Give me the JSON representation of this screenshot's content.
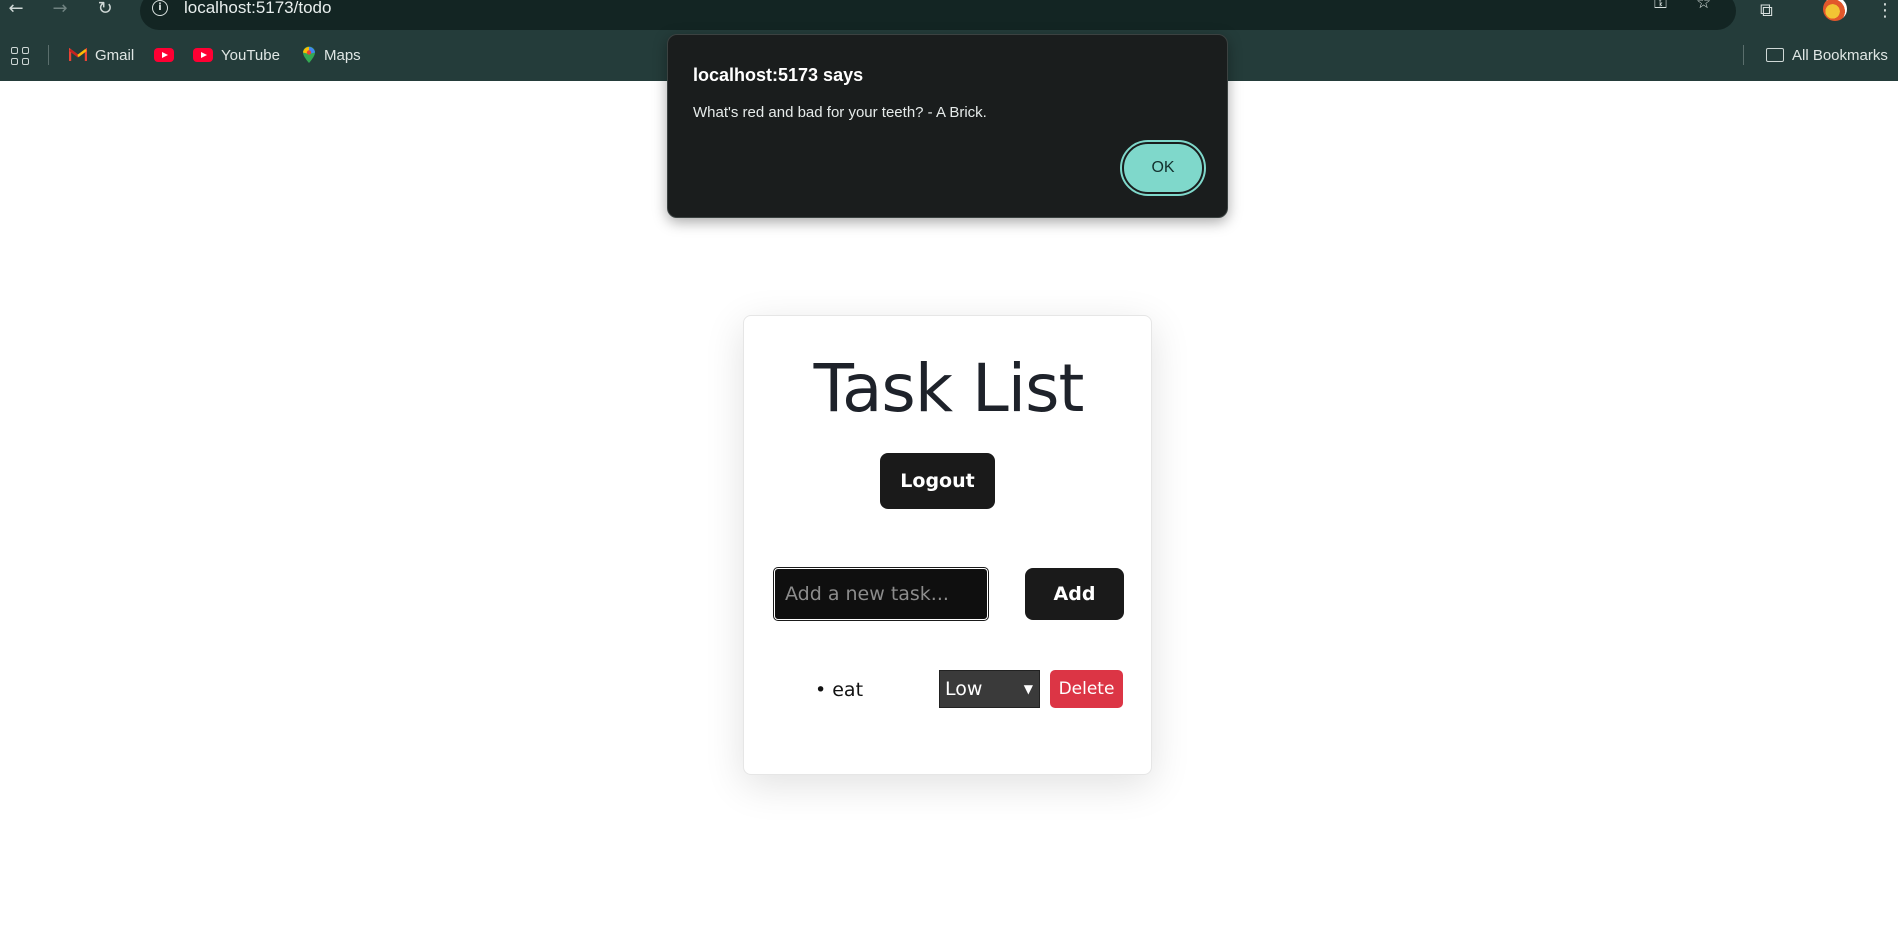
{
  "browser": {
    "url": "localhost:5173/todo",
    "bookmarks": [
      {
        "label": "Gmail",
        "icon": "gmail-icon"
      },
      {
        "label": "",
        "icon": "youtube-icon"
      },
      {
        "label": "YouTube",
        "icon": "youtube-icon"
      },
      {
        "label": "Maps",
        "icon": "maps-icon"
      }
    ],
    "all_bookmarks_label": "All Bookmarks"
  },
  "dialog": {
    "title": "localhost:5173 says",
    "message": "What's red and bad for your teeth? - A Brick.",
    "ok_label": "OK",
    "accent_color": "#7fd8cb"
  },
  "todo": {
    "title": "Task List",
    "logout_label": "Logout",
    "input_placeholder": "Add a new task...",
    "add_label": "Add",
    "tasks": [
      {
        "text": "• eat",
        "priority": "Low",
        "delete_label": "Delete"
      }
    ],
    "delete_color": "#dc3545"
  }
}
